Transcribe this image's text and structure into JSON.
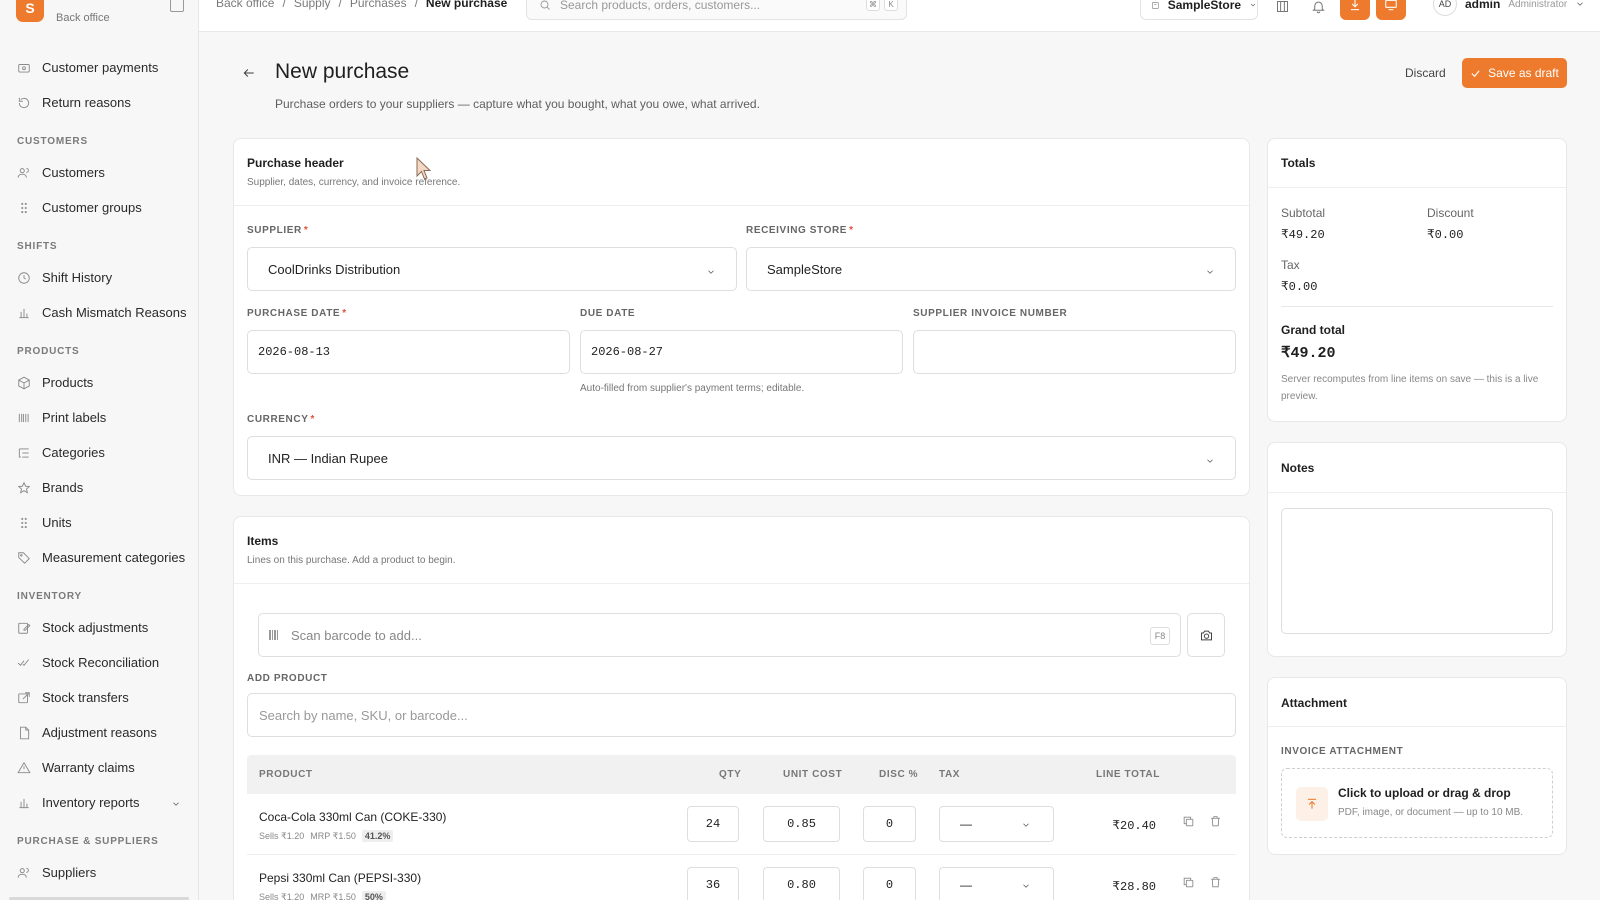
{
  "brand": {
    "logo_letter": "S",
    "subtitle": "Back office"
  },
  "sidebar": {
    "items": [
      {
        "type": "item",
        "label": "Customer payments",
        "icon": "wallet-icon"
      },
      {
        "type": "item",
        "label": "Return reasons",
        "icon": "undo-icon"
      },
      {
        "type": "section",
        "label": "CUSTOMERS"
      },
      {
        "type": "item",
        "label": "Customers",
        "icon": "users-icon"
      },
      {
        "type": "item",
        "label": "Customer groups",
        "icon": "grip-icon"
      },
      {
        "type": "section",
        "label": "SHIFTS"
      },
      {
        "type": "item",
        "label": "Shift History",
        "icon": "clock-icon"
      },
      {
        "type": "item",
        "label": "Cash Mismatch Reasons",
        "icon": "bar-chart-icon"
      },
      {
        "type": "section",
        "label": "PRODUCTS"
      },
      {
        "type": "item",
        "label": "Products",
        "icon": "box-icon"
      },
      {
        "type": "item",
        "label": "Print labels",
        "icon": "barcode-icon"
      },
      {
        "type": "item",
        "label": "Categories",
        "icon": "list-tree-icon"
      },
      {
        "type": "item",
        "label": "Brands",
        "icon": "star-icon"
      },
      {
        "type": "item",
        "label": "Units",
        "icon": "grip-icon"
      },
      {
        "type": "item",
        "label": "Measurement categories",
        "icon": "tag-icon"
      },
      {
        "type": "section",
        "label": "INVENTORY"
      },
      {
        "type": "item",
        "label": "Stock adjustments",
        "icon": "edit-icon"
      },
      {
        "type": "item",
        "label": "Stock Reconciliation",
        "icon": "check-check-icon"
      },
      {
        "type": "item",
        "label": "Stock transfers",
        "icon": "external-link-icon"
      },
      {
        "type": "item",
        "label": "Adjustment reasons",
        "icon": "file-icon"
      },
      {
        "type": "item",
        "label": "Warranty claims",
        "icon": "warning-icon"
      },
      {
        "type": "item",
        "label": "Inventory reports",
        "icon": "bar-chart-icon",
        "expandable": true
      },
      {
        "type": "section",
        "label": "PURCHASE & SUPPLIERS"
      },
      {
        "type": "item",
        "label": "Suppliers",
        "icon": "users-icon"
      }
    ]
  },
  "topbar": {
    "breadcrumbs": [
      "Back office",
      "Supply",
      "Purchases",
      "New purchase"
    ],
    "search_placeholder": "Search products, orders, customers...",
    "kbd_cmd": "⌘",
    "kbd_k": "K",
    "store": "SampleStore",
    "user": {
      "initials": "AD",
      "name": "admin",
      "role": "Administrator"
    }
  },
  "page": {
    "title": "New purchase",
    "subtitle": "Purchase orders to your suppliers — capture what you bought, what you owe, what arrived.",
    "discard_label": "Discard",
    "save_label": "Save as draft"
  },
  "header_card": {
    "title": "Purchase header",
    "desc": "Supplier, dates, currency, and invoice reference.",
    "supplier_label": "SUPPLIER",
    "supplier_value": "CoolDrinks Distribution",
    "store_label": "RECEIVING STORE",
    "store_value": "SampleStore",
    "purchase_date_label": "PURCHASE DATE",
    "purchase_date_value": "2026-08-13",
    "due_date_label": "DUE DATE",
    "due_date_value": "2026-08-27",
    "due_date_hint": "Auto-filled from supplier's payment terms; editable.",
    "invoice_label": "SUPPLIER INVOICE NUMBER",
    "invoice_value": "",
    "currency_label": "CURRENCY",
    "currency_value": "INR — Indian Rupee",
    "required_mark": "*"
  },
  "items_card": {
    "title": "Items",
    "desc": "Lines on this purchase. Add a product to begin.",
    "scan_placeholder": "Scan barcode to add...",
    "scan_shortcut": "F8",
    "add_product_label": "ADD PRODUCT",
    "search_placeholder": "Search by name, SKU, or barcode...",
    "columns": [
      "PRODUCT",
      "QTY",
      "UNIT COST",
      "DISC %",
      "TAX",
      "LINE TOTAL"
    ],
    "rows": [
      {
        "name": "Coca-Cola 330ml Can (COKE-330)",
        "sells": "Sells ₹1.20",
        "mrp": "MRP ₹1.50",
        "margin": "41.2%",
        "qty": "24",
        "unit_cost": "0.85",
        "disc": "0",
        "tax": "—",
        "line_total": "₹20.40"
      },
      {
        "name": "Pepsi 330ml Can (PEPSI-330)",
        "sells": "Sells ₹1.20",
        "mrp": "MRP ₹1.50",
        "margin": "50%",
        "qty": "36",
        "unit_cost": "0.80",
        "disc": "0",
        "tax": "—",
        "line_total": "₹28.80"
      }
    ]
  },
  "totals": {
    "title": "Totals",
    "subtotal_label": "Subtotal",
    "subtotal": "₹49.20",
    "discount_label": "Discount",
    "discount": "₹0.00",
    "tax_label": "Tax",
    "tax": "₹0.00",
    "grand_label": "Grand total",
    "grand": "₹49.20",
    "note": "Server recomputes from line items on save — this is a live preview."
  },
  "notes": {
    "title": "Notes",
    "value": ""
  },
  "attachment": {
    "title": "Attachment",
    "label": "INVOICE ATTACHMENT",
    "cta": "Click to upload or drag & drop",
    "hint": "PDF, image, or document — up to 10 MB."
  },
  "colors": {
    "accent": "#ee7a2d",
    "required": "#e0523a"
  }
}
